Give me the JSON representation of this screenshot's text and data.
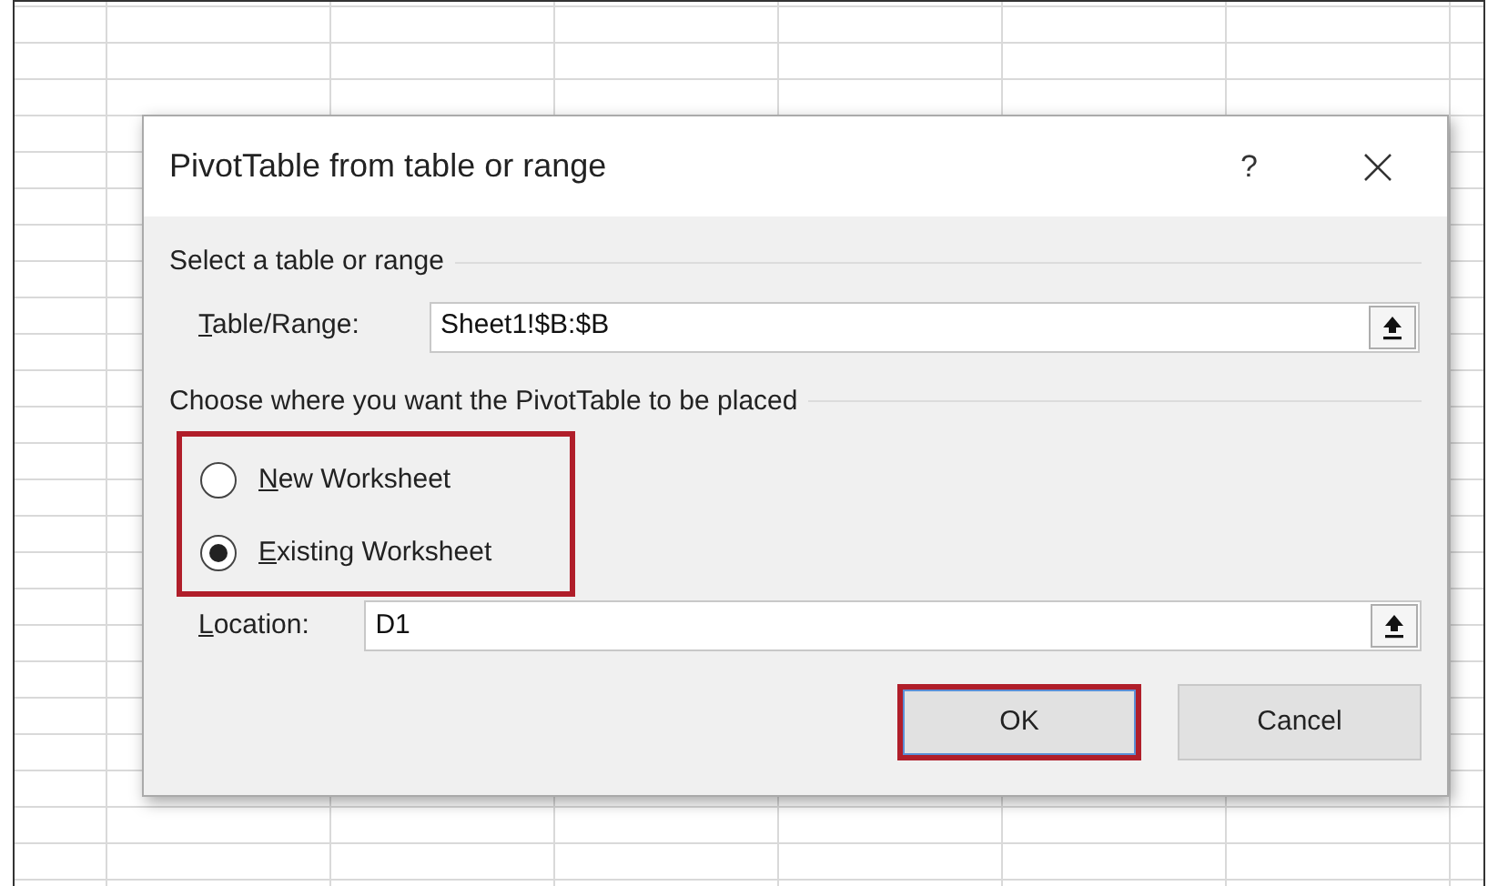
{
  "dialog": {
    "title": "PivotTable from table or range",
    "help": "?"
  },
  "source": {
    "heading": "Select a table or range",
    "label": "Table/Range:",
    "value": "Sheet1!$B:$B"
  },
  "placement": {
    "heading": "Choose where you want the PivotTable to be placed",
    "highlighted": true,
    "options": [
      {
        "label": "New Worksheet",
        "selected": false
      },
      {
        "label": "Existing Worksheet",
        "selected": true
      }
    ]
  },
  "location": {
    "label": "Location:",
    "value": "D1"
  },
  "buttons": [
    {
      "label": "OK",
      "highlighted": true
    },
    {
      "label": "Cancel",
      "highlighted": false
    }
  ]
}
